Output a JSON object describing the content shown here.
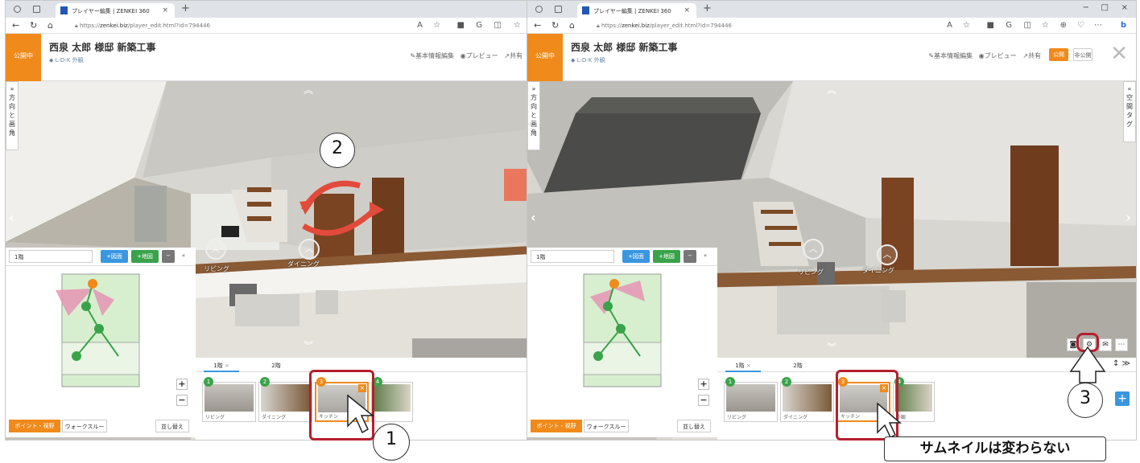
{
  "left": {
    "browser": {
      "tab_title": "プレイヤー編集 | ZENKEI 360",
      "tab_close": "×",
      "new_tab": "+",
      "url_prefix": "https://",
      "url_host": "zenkei.biz",
      "url_path": "/player_edit.html?id=794446"
    },
    "header": {
      "status": "公開中",
      "title": "西泉 太郎 様邸 新築工事",
      "subtitle": "L-D-K 外観",
      "edit_info": "基本情報編集",
      "preview": "プレビュー",
      "share": "共有"
    },
    "side_tab_label": "方向と画角",
    "scene": {
      "markers": [
        {
          "label": "リビング"
        },
        {
          "label": "ダイニング"
        }
      ]
    },
    "map": {
      "floor": "1階",
      "add_plan": "+図面",
      "add_map": "+地図",
      "minus": "−",
      "collapse": "«",
      "zoom_in": "+",
      "zoom_out": "−",
      "mode_active": "ポイント・視野",
      "mode_walk": "ウォークスルー",
      "reorder": "並し替え",
      "points": [
        "1",
        "2",
        "3",
        "4"
      ]
    },
    "floor_tabs": [
      "1階",
      "2階"
    ],
    "thumbnails": [
      {
        "badge": "1",
        "label": "リビング",
        "color": "#3aa34a"
      },
      {
        "badge": "2",
        "label": "ダイニング",
        "color": "#3aa34a"
      },
      {
        "badge": "3",
        "label": "キッチン",
        "color": "#f08a1a"
      },
      {
        "badge": "4",
        "label": "",
        "color": "#3aa34a"
      }
    ]
  },
  "right": {
    "browser": {
      "tab_title": "プレイヤー編集 | ZENKEI 360",
      "tab_close": "×",
      "new_tab": "+",
      "url_prefix": "https://",
      "url_host": "zenkei.biz",
      "url_path": "/player_edit.html?id=794446",
      "win_min": "−",
      "win_max": "□",
      "win_close": "×"
    },
    "header": {
      "status": "公開中",
      "title": "西泉 太郎 様邸 新築工事",
      "subtitle": "L-D-K 外観",
      "edit_info": "基本情報編集",
      "preview": "プレビュー",
      "share": "共有",
      "public_btn": "公開",
      "private_btn": "非公開"
    },
    "side_tab_label": "方向と画角",
    "side_tab_right": "空間タグ",
    "scene": {
      "markers": [
        {
          "label": "リビング"
        },
        {
          "label": "ダイニング"
        }
      ]
    },
    "map": {
      "floor": "1階",
      "add_plan": "+図面",
      "add_map": "+地図",
      "minus": "−",
      "collapse": "«",
      "zoom_in": "+",
      "zoom_out": "−",
      "mode_active": "ポイント・視野",
      "mode_walk": "ウォークスルー",
      "reorder": "並し替え"
    },
    "floor_tabs": [
      "1階",
      "2階"
    ],
    "thumbnails": [
      {
        "badge": "1",
        "label": "リビング",
        "color": "#3aa34a"
      },
      {
        "badge": "2",
        "label": "ダイニング",
        "color": "#3aa34a"
      },
      {
        "badge": "3",
        "label": "キッチン",
        "color": "#f08a1a"
      },
      {
        "badge": "4",
        "label": "外観",
        "color": "#3aa34a"
      }
    ],
    "add_button": "+"
  },
  "callouts": {
    "step1": "1",
    "step2": "2",
    "step3": "3",
    "caption": "サムネイルは変わらない"
  }
}
